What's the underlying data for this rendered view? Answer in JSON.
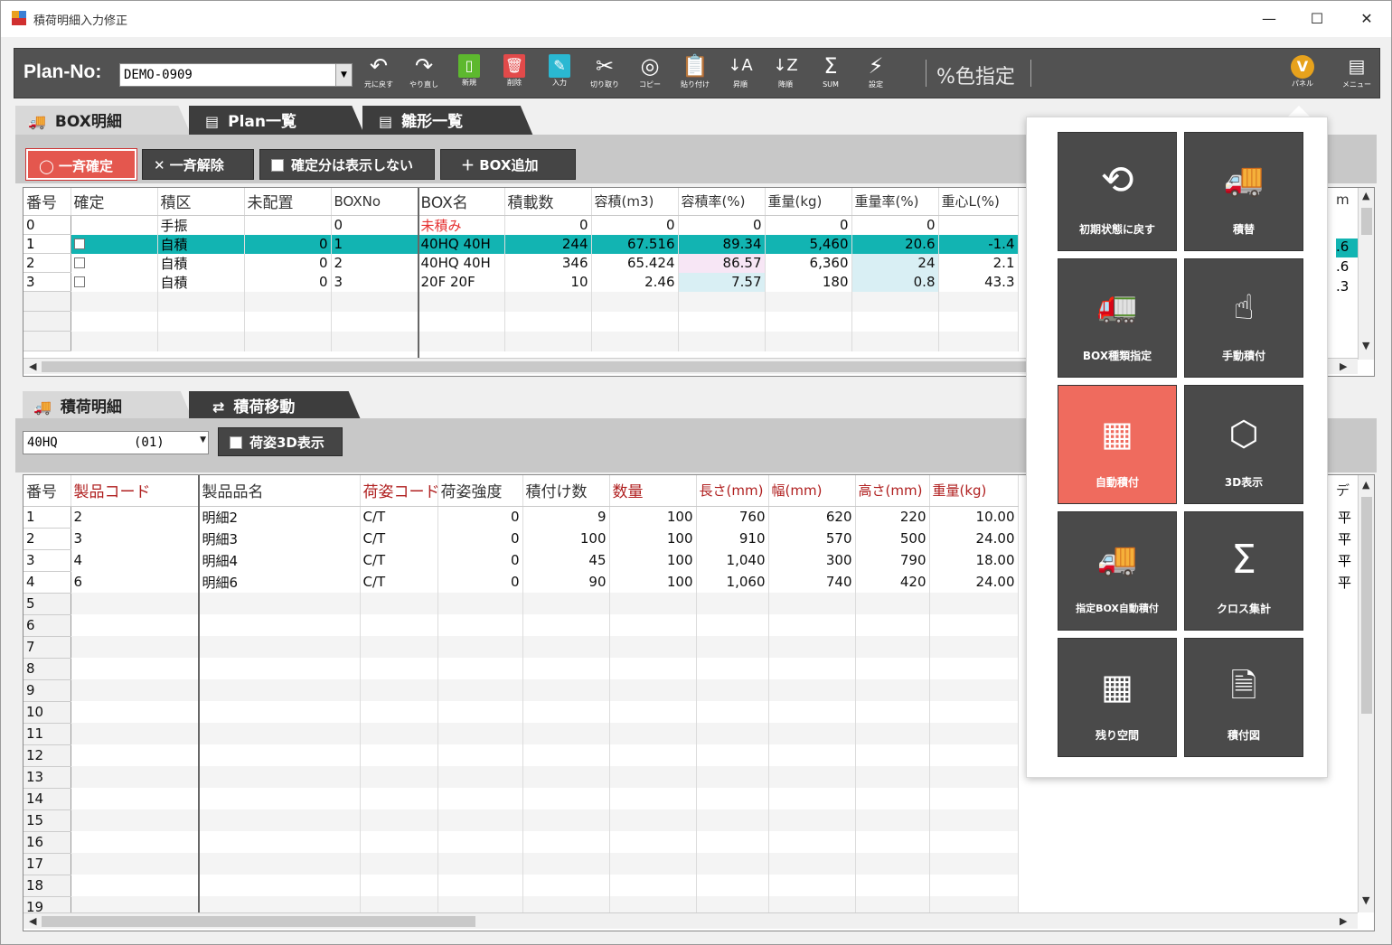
{
  "window": {
    "title": "積荷明細入力修正",
    "min": "—",
    "max": "☐",
    "close": "✕"
  },
  "toolbar": {
    "plan_label": "Plan-No:",
    "plan_value": "DEMO-0909",
    "buttons": [
      {
        "label": "元に戻す",
        "icon": "undo-icon"
      },
      {
        "label": "やり直し",
        "icon": "redo-icon"
      },
      {
        "label": "新規",
        "icon": "new-icon"
      },
      {
        "label": "削除",
        "icon": "delete-icon"
      },
      {
        "label": "入力",
        "icon": "edit-icon"
      },
      {
        "label": "切り取り",
        "icon": "cut-icon"
      },
      {
        "label": "コピー",
        "icon": "copy-icon"
      },
      {
        "label": "貼り付け",
        "icon": "paste-icon"
      },
      {
        "label": "昇順",
        "icon": "sort-asc-icon"
      },
      {
        "label": "降順",
        "icon": "sort-desc-icon"
      },
      {
        "label": "SUM",
        "icon": "sum-icon"
      },
      {
        "label": "設定",
        "icon": "bolt-icon"
      }
    ],
    "color_spec": "%色指定",
    "panel_label": "パネル",
    "menu_label": "メニュー"
  },
  "top_tabs": [
    "BOX明細",
    "Plan一覧",
    "雛形一覧"
  ],
  "actions": {
    "confirm_all": "一斉確定",
    "release_all": "一斉解除",
    "hide_confirmed": "確定分は表示しない",
    "add_box": "BOX追加"
  },
  "box_grid": {
    "headers": [
      "番号",
      "確定",
      "積区",
      "未配置",
      "BOXNo",
      "BOX名",
      "積載数",
      "容積(m3)",
      "容積率(%)",
      "重量(kg)",
      "重量率(%)",
      "重心L(%)"
    ],
    "right_header": "m",
    "rows": [
      {
        "no": "0",
        "kubun": "手振",
        "unplaced": "",
        "boxno": "0",
        "name": "未積み",
        "count": "0",
        "vol": "0",
        "volrate": "0",
        "weight": "0",
        "wrate": "0",
        "center": ""
      },
      {
        "no": "1",
        "kubun": "自積",
        "unplaced": "0",
        "boxno": "1",
        "name": "40HQ   40H",
        "count": "244",
        "vol": "67.516",
        "volrate": "89.34",
        "weight": "5,460",
        "wrate": "20.6",
        "center": "-1.4",
        "right": ".6"
      },
      {
        "no": "2",
        "kubun": "自積",
        "unplaced": "0",
        "boxno": "2",
        "name": "40HQ   40H",
        "count": "346",
        "vol": "65.424",
        "volrate": "86.57",
        "weight": "6,360",
        "wrate": "24",
        "center": "2.1",
        "right": ".6"
      },
      {
        "no": "3",
        "kubun": "自積",
        "unplaced": "0",
        "boxno": "3",
        "name": "20F   20F",
        "count": "10",
        "vol": "2.46",
        "volrate": "7.57",
        "weight": "180",
        "wrate": "0.8",
        "center": "43.3",
        "right": ".3"
      }
    ]
  },
  "bottom_tabs": [
    "積荷明細",
    "積荷移動"
  ],
  "box_select": "40HQ          (01)",
  "show_3d": "荷姿3D表示",
  "item_grid": {
    "headers": [
      "番号",
      "製品コード",
      "製品品名",
      "荷姿コード",
      "荷姿強度",
      "積付け数",
      "数量",
      "長さ(mm)",
      "幅(mm)",
      "高さ(mm)",
      "重量(kg)"
    ],
    "right_header": "デ",
    "rows": [
      {
        "no": "1",
        "code": "2",
        "name": "明細2",
        "pack": "C/T",
        "strength": "0",
        "stack": "9",
        "qty": "100",
        "len": "760",
        "wid": "620",
        "hei": "220",
        "wt": "10.00",
        "right": "平"
      },
      {
        "no": "2",
        "code": "3",
        "name": "明細3",
        "pack": "C/T",
        "strength": "0",
        "stack": "100",
        "qty": "100",
        "len": "910",
        "wid": "570",
        "hei": "500",
        "wt": "24.00",
        "right": "平"
      },
      {
        "no": "3",
        "code": "4",
        "name": "明細4",
        "pack": "C/T",
        "strength": "0",
        "stack": "45",
        "qty": "100",
        "len": "1,040",
        "wid": "300",
        "hei": "790",
        "wt": "18.00",
        "right": "平"
      },
      {
        "no": "4",
        "code": "6",
        "name": "明細6",
        "pack": "C/T",
        "strength": "0",
        "stack": "90",
        "qty": "100",
        "len": "1,060",
        "wid": "740",
        "hei": "420",
        "wt": "24.00",
        "right": "平"
      }
    ],
    "empty_row_numbers": [
      "5",
      "6",
      "7",
      "8",
      "9",
      "10",
      "11",
      "12",
      "13",
      "14",
      "15",
      "16",
      "17",
      "18",
      "19"
    ]
  },
  "panel": {
    "buttons": [
      {
        "label": "初期状態に戻す",
        "icon": "history-icon"
      },
      {
        "label": "積替",
        "icon": "truck-reload-icon"
      },
      {
        "label": "BOX種類指定",
        "icon": "truck-icon"
      },
      {
        "label": "手動積付",
        "icon": "hand-pointer-icon"
      },
      {
        "label": "自動積付",
        "icon": "auto-stack-icon",
        "highlight": true
      },
      {
        "label": "3D表示",
        "icon": "3d-box-icon"
      },
      {
        "label": "指定BOX自動積付",
        "icon": "truck-boxes-icon"
      },
      {
        "label": "クロス集計",
        "icon": "sigma-icon"
      },
      {
        "label": "残り空間",
        "icon": "grid-space-icon"
      },
      {
        "label": "積付図",
        "icon": "stack-diagram-icon"
      }
    ]
  },
  "colors": {
    "accent_teal": "#12b4b2",
    "accent_red": "#ef6b5e",
    "toolbar_bg": "#525252",
    "panel_orange": "#e7a21c"
  }
}
